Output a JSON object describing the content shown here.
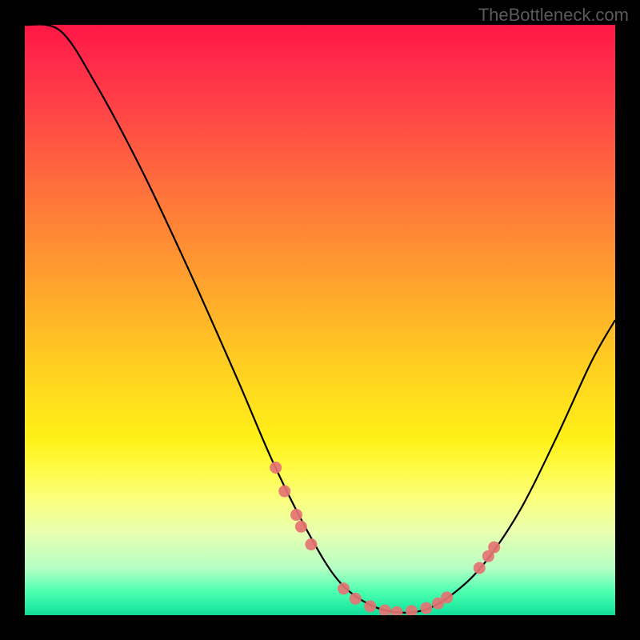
{
  "watermark": "TheBottleneck.com",
  "chart_data": {
    "type": "line",
    "title": "",
    "xlabel": "",
    "ylabel": "",
    "xlim": [
      0,
      100
    ],
    "ylim": [
      0,
      100
    ],
    "curve": [
      {
        "x": 0,
        "y": 100
      },
      {
        "x": 6,
        "y": 99
      },
      {
        "x": 12,
        "y": 90
      },
      {
        "x": 20,
        "y": 75
      },
      {
        "x": 28,
        "y": 58
      },
      {
        "x": 36,
        "y": 40
      },
      {
        "x": 42,
        "y": 26
      },
      {
        "x": 48,
        "y": 14
      },
      {
        "x": 53,
        "y": 6
      },
      {
        "x": 58,
        "y": 2
      },
      {
        "x": 63,
        "y": 0.5
      },
      {
        "x": 68,
        "y": 1
      },
      {
        "x": 73,
        "y": 4
      },
      {
        "x": 78,
        "y": 9
      },
      {
        "x": 84,
        "y": 18
      },
      {
        "x": 90,
        "y": 30
      },
      {
        "x": 96,
        "y": 43
      },
      {
        "x": 100,
        "y": 50
      }
    ],
    "markers": [
      {
        "x": 42.5,
        "y": 25
      },
      {
        "x": 44,
        "y": 21
      },
      {
        "x": 46,
        "y": 17
      },
      {
        "x": 46.8,
        "y": 15
      },
      {
        "x": 48.5,
        "y": 12
      },
      {
        "x": 54,
        "y": 4.5
      },
      {
        "x": 56,
        "y": 2.8
      },
      {
        "x": 58.5,
        "y": 1.5
      },
      {
        "x": 61,
        "y": 0.8
      },
      {
        "x": 63,
        "y": 0.5
      },
      {
        "x": 65.5,
        "y": 0.7
      },
      {
        "x": 68,
        "y": 1.2
      },
      {
        "x": 70,
        "y": 2
      },
      {
        "x": 71.5,
        "y": 3
      },
      {
        "x": 77,
        "y": 8
      },
      {
        "x": 78.5,
        "y": 10
      },
      {
        "x": 79.5,
        "y": 11.5
      }
    ]
  }
}
